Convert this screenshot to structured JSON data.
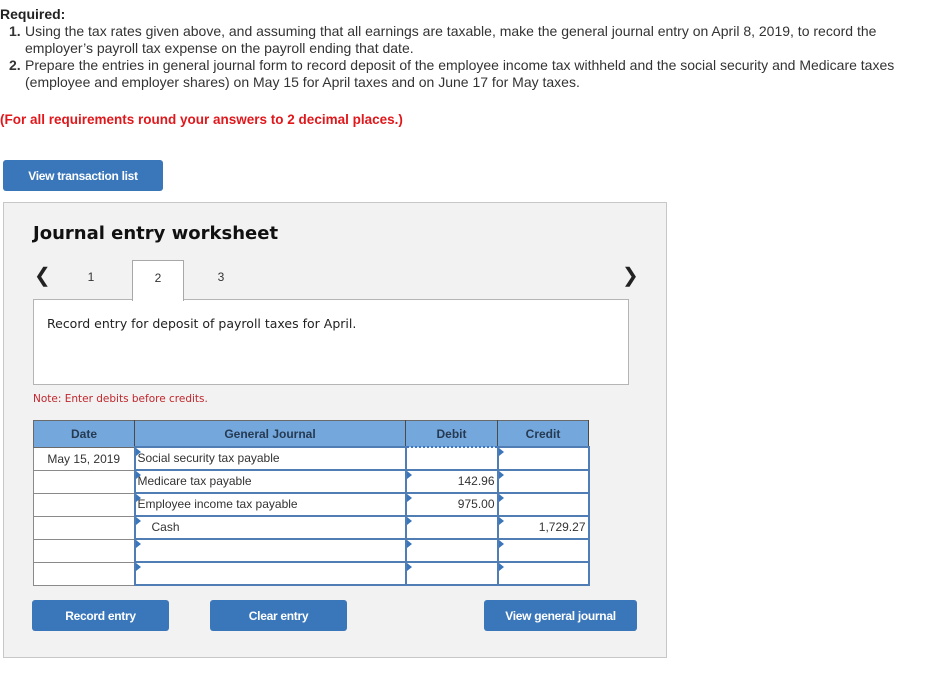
{
  "required": {
    "heading": "Required:",
    "items": [
      {
        "num": "1.",
        "text": "Using the tax rates given above, and assuming that all earnings are taxable, make the general journal entry on April 8, 2019, to record the employer’s payroll tax expense on the payroll ending that date."
      },
      {
        "num": "2.",
        "text": "Prepare the entries in general journal form to record deposit of the employee income tax withheld and the social security and Medicare taxes (employee and employer shares) on May 15 for April taxes and on June 17 for May taxes."
      }
    ],
    "rounding_note": "(For all requirements round your answers to 2 decimal places.)"
  },
  "buttons": {
    "view_transaction_list": "View transaction list",
    "record_entry": "Record entry",
    "clear_entry": "Clear entry",
    "view_general_journal": "View general journal"
  },
  "worksheet": {
    "title": "Journal entry worksheet",
    "nav_prev": "‹",
    "nav_next": "›",
    "tabs": [
      "1",
      "2",
      "3"
    ],
    "active_tab": "2",
    "description": "Record entry for deposit of payroll taxes for April.",
    "note": "Note: Enter debits before credits."
  },
  "journal": {
    "headers": {
      "date": "Date",
      "account": "General Journal",
      "debit": "Debit",
      "credit": "Credit"
    },
    "rows": [
      {
        "date": "May 15, 2019",
        "account": "Social security tax payable",
        "debit": "",
        "credit": ""
      },
      {
        "date": "",
        "account": "Medicare tax payable",
        "debit": "142.96",
        "credit": ""
      },
      {
        "date": "",
        "account": "Employee income tax payable",
        "debit": "975.00",
        "credit": ""
      },
      {
        "date": "",
        "account": "Cash",
        "debit": "",
        "credit": "1,729.27"
      },
      {
        "date": "",
        "account": "",
        "debit": "",
        "credit": ""
      },
      {
        "date": "",
        "account": "",
        "debit": "",
        "credit": ""
      }
    ]
  }
}
